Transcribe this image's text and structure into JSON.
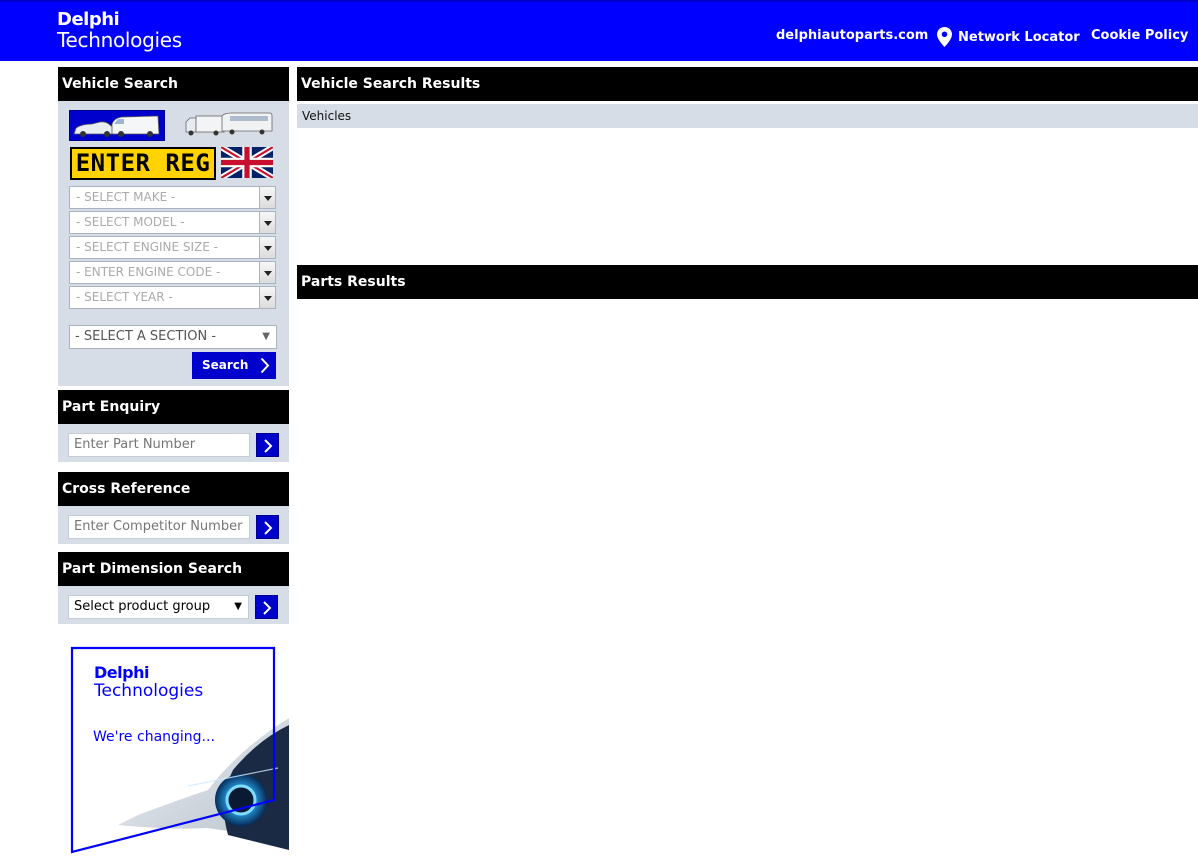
{
  "header": {
    "logo_line1": "Delphi",
    "logo_line2": "Technologies",
    "nav": {
      "site": "delphiautoparts.com",
      "locator": "Network Locator",
      "cookie": "Cookie Policy"
    },
    "brand_color": "#0000ff"
  },
  "vehicle_search": {
    "title": "Vehicle Search",
    "reg_plate": "ENTER REG",
    "selects": [
      "- SELECT MAKE -",
      "- SELECT MODEL -",
      "- SELECT ENGINE SIZE -",
      "- ENTER ENGINE CODE -",
      "- SELECT YEAR -"
    ],
    "section": "- SELECT A SECTION -",
    "search_label": "Search"
  },
  "part_enquiry": {
    "title": "Part Enquiry",
    "placeholder": "Enter Part Number"
  },
  "cross_reference": {
    "title": "Cross Reference",
    "placeholder": "Enter Competitor Number"
  },
  "dimension_search": {
    "title": "Part Dimension Search",
    "selected": "Select product group"
  },
  "ad": {
    "logo_line1": "Delphi",
    "logo_line2": "Technologies",
    "tagline": "We're changing..."
  },
  "main": {
    "results_title": "Vehicle Search Results",
    "vehicles_label": "Vehicles",
    "parts_title": "Parts Results"
  }
}
